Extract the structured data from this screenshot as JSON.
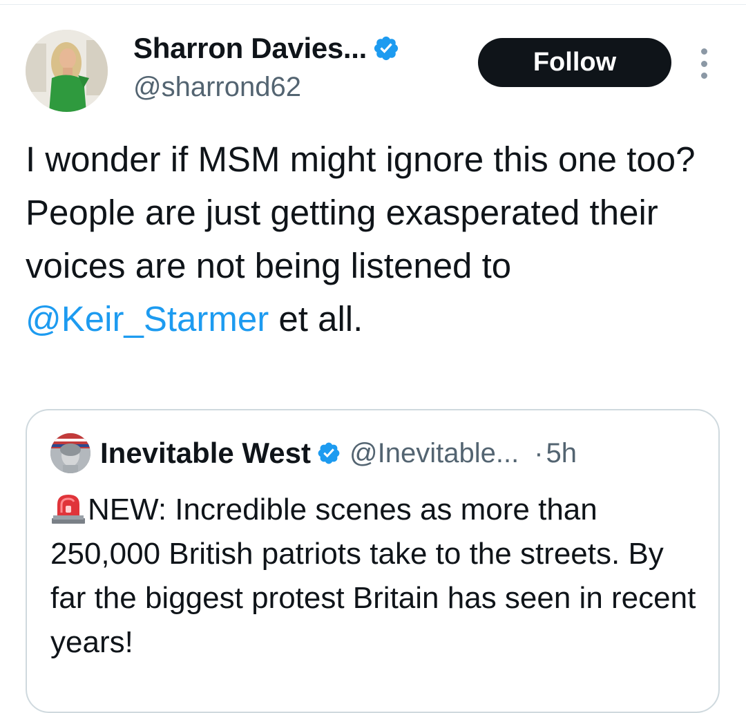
{
  "tweet": {
    "author": {
      "display_name": "Sharron Davies...",
      "handle": "@sharrond62",
      "verified": true
    },
    "follow_label": "Follow",
    "text_before_mention": "I wonder if MSM might ignore this one too? People are just getting exasperated their voices are not being listened to ",
    "mention": "@Keir_Starmer",
    "text_after_mention": " et all."
  },
  "quoted_tweet": {
    "author": {
      "display_name": "Inevitable West",
      "handle": "@Inevitable...",
      "verified": true
    },
    "separator": "·",
    "time": "5h",
    "emoji": "rotating-light-siren-icon",
    "text": "NEW: Incredible scenes as more than 250,000 British patriots take to the streets. By far the biggest protest Britain has seen in recent years!"
  },
  "colors": {
    "verified_blue": "#1d9bf0",
    "mention_blue": "#1d9bf0",
    "follow_button_bg": "#0f1419",
    "secondary_text": "#536471",
    "card_border": "#cfd9de"
  }
}
